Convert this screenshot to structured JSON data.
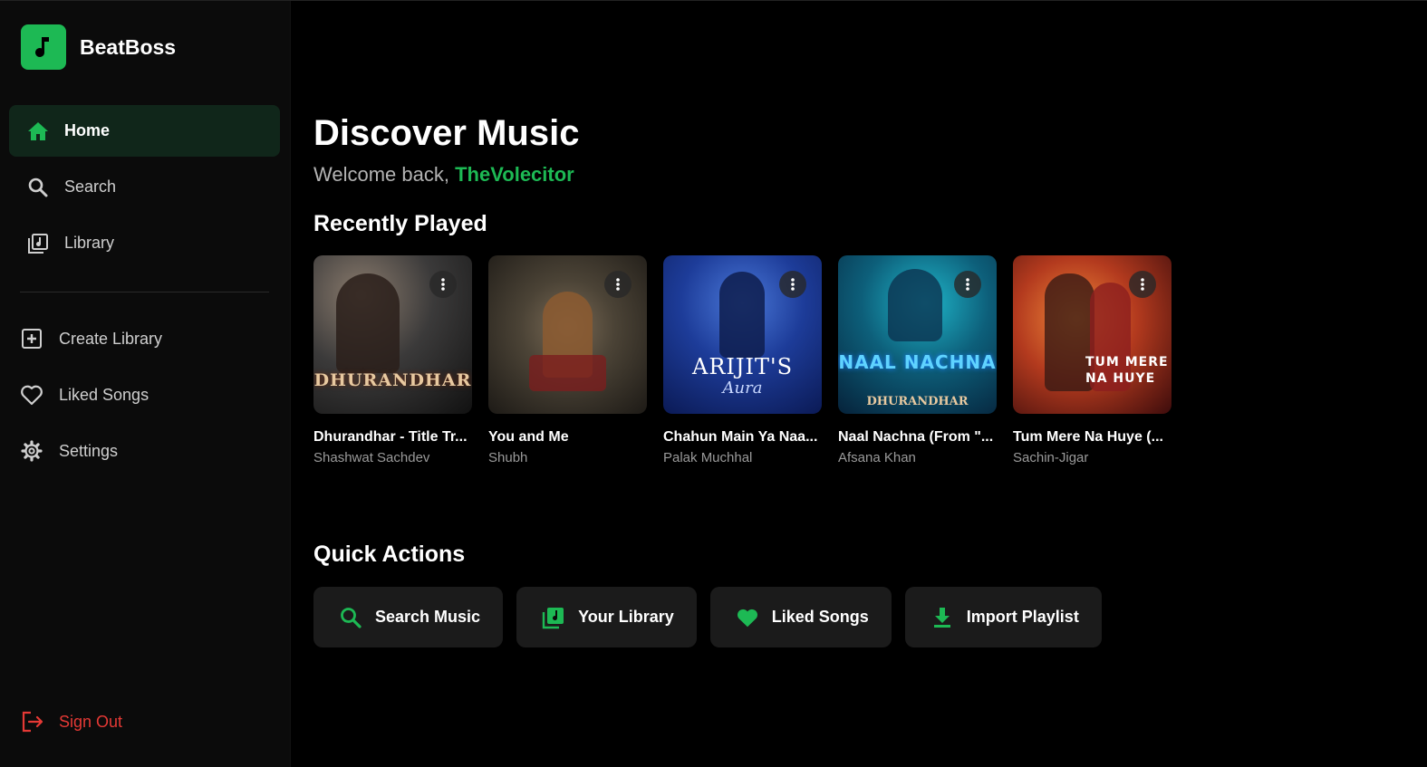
{
  "brand": {
    "name": "BeatBoss",
    "icon": "music-note-icon"
  },
  "nav": [
    {
      "label": "Home",
      "icon": "home-icon",
      "active": true
    },
    {
      "label": "Search",
      "icon": "search-icon",
      "active": false
    },
    {
      "label": "Library",
      "icon": "library-icon",
      "active": false
    }
  ],
  "nav2": [
    {
      "label": "Create Library",
      "icon": "plus-square-icon"
    },
    {
      "label": "Liked Songs",
      "icon": "heart-outline-icon"
    },
    {
      "label": "Settings",
      "icon": "gear-icon"
    }
  ],
  "signout": {
    "label": "Sign Out",
    "icon": "logout-icon"
  },
  "main": {
    "title": "Discover Music",
    "welcome_prefix": "Welcome back, ",
    "username": "TheVolecitor",
    "recent_title": "Recently Played",
    "quick_title": "Quick Actions"
  },
  "recent": [
    {
      "title": "Dhurandhar - Title Tr...",
      "artist": "Shashwat Sachdev",
      "cover_text": "DHURANDHAR"
    },
    {
      "title": "You and Me",
      "artist": "Shubh",
      "cover_text": ""
    },
    {
      "title": "Chahun Main Ya Naa...",
      "artist": "Palak Muchhal",
      "cover_text": "ARIJIT'S"
    },
    {
      "title": "Naal Nachna (From \"...",
      "artist": "Afsana Khan",
      "cover_text": "NAAL NACHNA"
    },
    {
      "title": "Tum Mere Na Huye (...",
      "artist": "Sachin-Jigar",
      "cover_text": "TUM MERE NA HUYE"
    }
  ],
  "quick_actions": [
    {
      "label": "Search Music",
      "icon": "search-icon"
    },
    {
      "label": "Your Library",
      "icon": "library-icon"
    },
    {
      "label": "Liked Songs",
      "icon": "heart-icon"
    },
    {
      "label": "Import Playlist",
      "icon": "download-icon"
    }
  ],
  "colors": {
    "accent": "#1db954",
    "danger": "#e53935",
    "background": "#000000",
    "sidebar": "#0b0b0b"
  }
}
